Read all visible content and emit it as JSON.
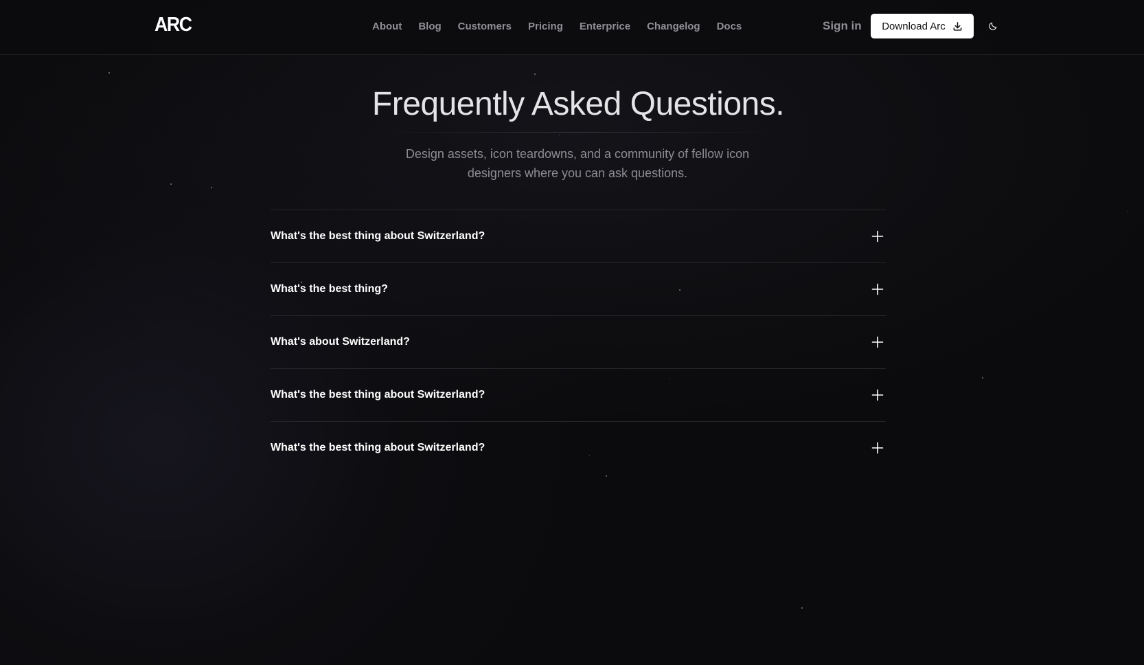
{
  "brand": {
    "logo_text": "ARC"
  },
  "nav": {
    "items": [
      "About",
      "Blog",
      "Customers",
      "Pricing",
      "Enterprice",
      "Changelog",
      "Docs"
    ]
  },
  "header": {
    "signin_label": "Sign in",
    "download_label": "Download Arc",
    "download_icon": "download-icon",
    "theme_icon": "moon-icon"
  },
  "hero": {
    "title": "Frequently Asked Questions.",
    "subtitle": "Design assets, icon teardowns, and a community of fellow icon designers where you can ask questions."
  },
  "faq": {
    "expand_icon": "plus-icon",
    "items": [
      {
        "question": "What's the best thing about Switzerland?"
      },
      {
        "question": "What's the best thing?"
      },
      {
        "question": "What's about Switzerland?"
      },
      {
        "question": "What's the best thing about Switzerland?"
      },
      {
        "question": "What's the best thing about Switzerland?"
      }
    ]
  },
  "colors": {
    "background": "#0b0b0d",
    "text_primary": "#ffffff",
    "text_muted": "#8e8e94",
    "divider": "#25252a",
    "button_bg": "#ffffff",
    "button_text": "#111114"
  }
}
